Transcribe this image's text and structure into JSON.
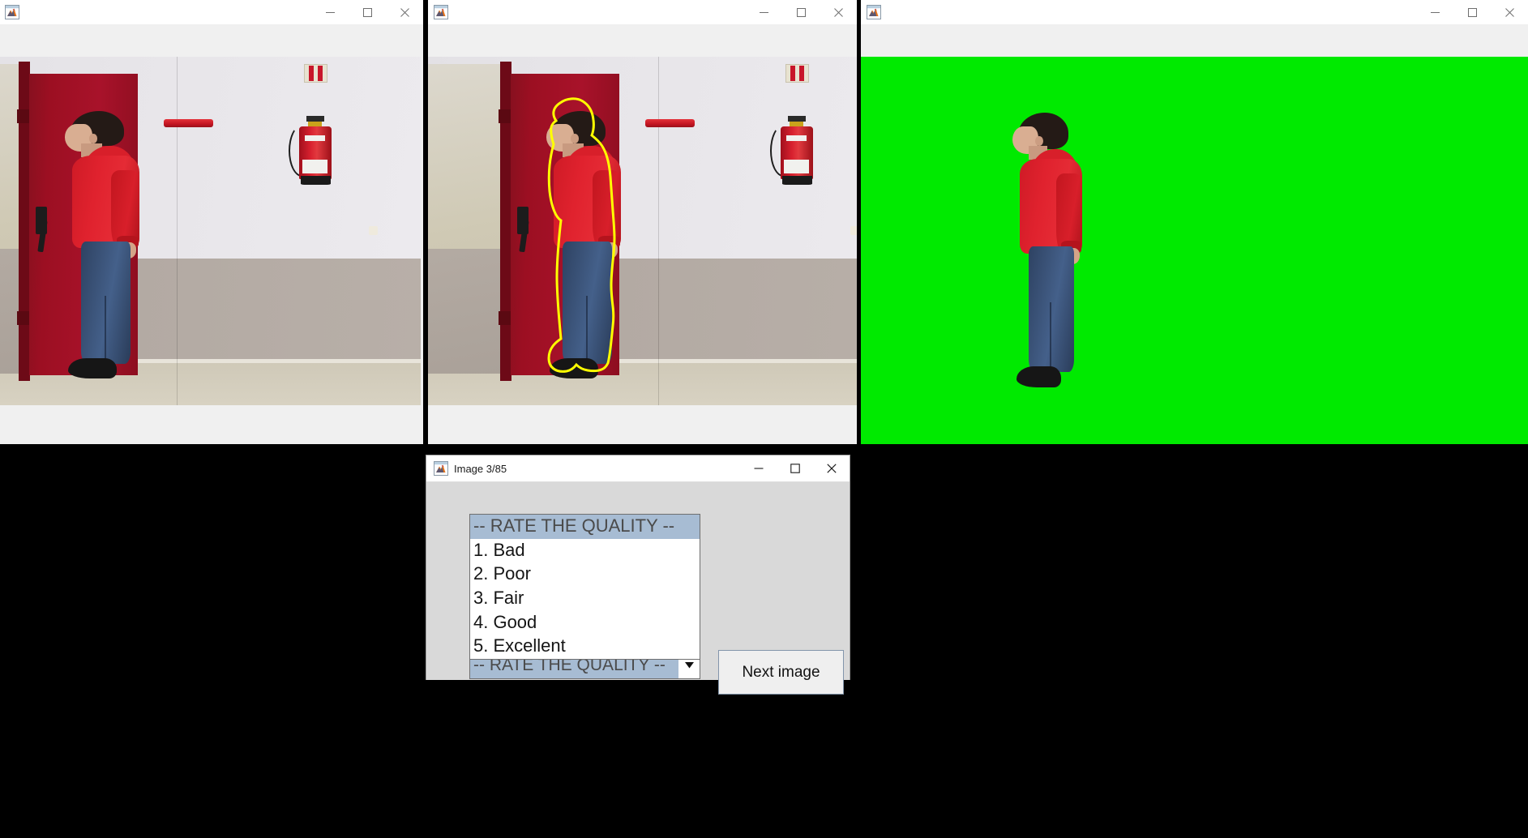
{
  "windows": [
    {
      "id": "figure-original",
      "title": "",
      "icon": "matlab-figure-icon",
      "controls": [
        "minimize",
        "maximize",
        "close"
      ]
    },
    {
      "id": "figure-contour",
      "title": "",
      "icon": "matlab-figure-icon",
      "controls": [
        "minimize",
        "maximize",
        "close"
      ]
    },
    {
      "id": "figure-segmented",
      "title": "",
      "icon": "matlab-figure-icon",
      "controls": [
        "minimize",
        "maximize",
        "close"
      ]
    }
  ],
  "window_controls": {
    "minimize_label": "—",
    "maximize_label": "□",
    "close_label": "×"
  },
  "dialog": {
    "title": "Image 3/85",
    "icon": "matlab-figure-icon",
    "controls": {
      "minimize_label": "—",
      "maximize_label": "□",
      "close_label": "×"
    },
    "listbox": {
      "header": "-- RATE THE QUALITY --",
      "options": [
        "1. Bad",
        "2. Poor",
        "3. Fair",
        "4. Good",
        "5. Excellent"
      ]
    },
    "combo": {
      "selected": "-- RATE THE QUALITY --",
      "arrow_icon": "chevron-down-icon"
    },
    "next_button": {
      "label": "Next image"
    }
  },
  "colors": {
    "desktop_background": "#000000",
    "figure_background": "#f0f0f0",
    "dialog_background": "#d9d9d9",
    "selection_blue": "#a7bcd3",
    "chroma_green": "#00ea00",
    "contour_yellow": "#ffff00",
    "hoodie_red": "#d81f2a",
    "door_red": "#9c0f22",
    "jeans_blue": "#3a5277"
  },
  "scene": {
    "description": "Man in red hoodie and blue jeans standing in profile in front of a red fire door, with a fire extinguisher mounted on the wall"
  }
}
